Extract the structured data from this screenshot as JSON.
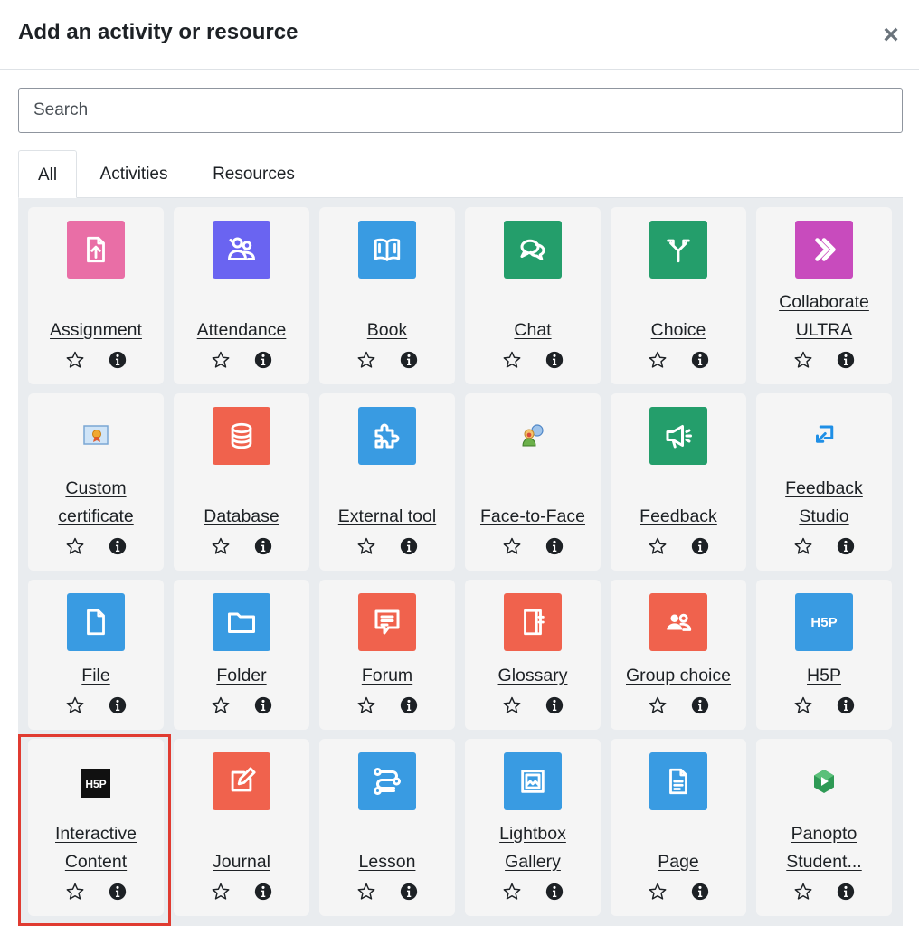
{
  "modal": {
    "title": "Add an activity or resource",
    "close_symbol": "×"
  },
  "search": {
    "placeholder": "Search",
    "value": ""
  },
  "tabs": [
    {
      "label": "All",
      "active": true
    },
    {
      "label": "Activities",
      "active": false
    },
    {
      "label": "Resources",
      "active": false
    }
  ],
  "rows": [
    [
      {
        "lines": [
          "Assignment"
        ],
        "icon": "assignment-icon",
        "color": "#e96ea6"
      },
      {
        "lines": [
          "Attendance"
        ],
        "icon": "attendance-icon",
        "color": "#6a64f1"
      },
      {
        "lines": [
          "Book"
        ],
        "icon": "book-icon",
        "color": "#399be2"
      },
      {
        "lines": [
          "Chat"
        ],
        "icon": "chat-icon",
        "color": "#249e6b"
      },
      {
        "lines": [
          "Choice"
        ],
        "icon": "choice-icon",
        "color": "#249e6b"
      },
      {
        "lines": [
          "Collaborate",
          "ULTRA"
        ],
        "icon": "collaborate-icon",
        "color": "#c84bbd"
      }
    ],
    [
      {
        "lines": [
          "Custom",
          "certificate"
        ],
        "icon": "certificate-icon",
        "color": ""
      },
      {
        "lines": [
          "Database"
        ],
        "icon": "database-icon",
        "color": "#f0624d"
      },
      {
        "lines": [
          "External tool"
        ],
        "icon": "puzzle-icon",
        "color": "#399be2"
      },
      {
        "lines": [
          "Face-to-Face"
        ],
        "icon": "face-to-face-icon",
        "color": ""
      },
      {
        "lines": [
          "Feedback"
        ],
        "icon": "megaphone-icon",
        "color": "#249e6b"
      },
      {
        "lines": [
          "Feedback",
          "Studio"
        ],
        "icon": "feedback-studio-icon",
        "color": ""
      }
    ],
    [
      {
        "lines": [
          "File"
        ],
        "icon": "file-icon",
        "color": "#399be2"
      },
      {
        "lines": [
          "Folder"
        ],
        "icon": "folder-icon",
        "color": "#399be2"
      },
      {
        "lines": [
          "Forum"
        ],
        "icon": "forum-icon",
        "color": "#f0624d"
      },
      {
        "lines": [
          "Glossary"
        ],
        "icon": "glossary-icon",
        "color": "#f0624d"
      },
      {
        "lines": [
          "Group choice"
        ],
        "icon": "group-choice-icon",
        "color": "#f0624d"
      },
      {
        "lines": [
          "H5P"
        ],
        "icon": "h5p-icon",
        "color": "#399be2"
      }
    ],
    [
      {
        "lines": [
          "Interactive",
          "Content"
        ],
        "icon": "h5p-black-icon",
        "color": "#111111"
      },
      {
        "lines": [
          "Journal"
        ],
        "icon": "journal-icon",
        "color": "#f0624d"
      },
      {
        "lines": [
          "Lesson"
        ],
        "icon": "lesson-icon",
        "color": "#399be2"
      },
      {
        "lines": [
          "Lightbox",
          "Gallery"
        ],
        "icon": "lightbox-icon",
        "color": "#399be2"
      },
      {
        "lines": [
          "Page"
        ],
        "icon": "page-icon",
        "color": "#399be2"
      },
      {
        "lines": [
          "Panopto",
          "Student..."
        ],
        "icon": "panopto-icon",
        "color": ""
      }
    ]
  ],
  "star_icon": "star-outline-icon",
  "info_icon": "info-circle-icon",
  "highlight_color": "#e03b31",
  "H5P_text": "H5P"
}
